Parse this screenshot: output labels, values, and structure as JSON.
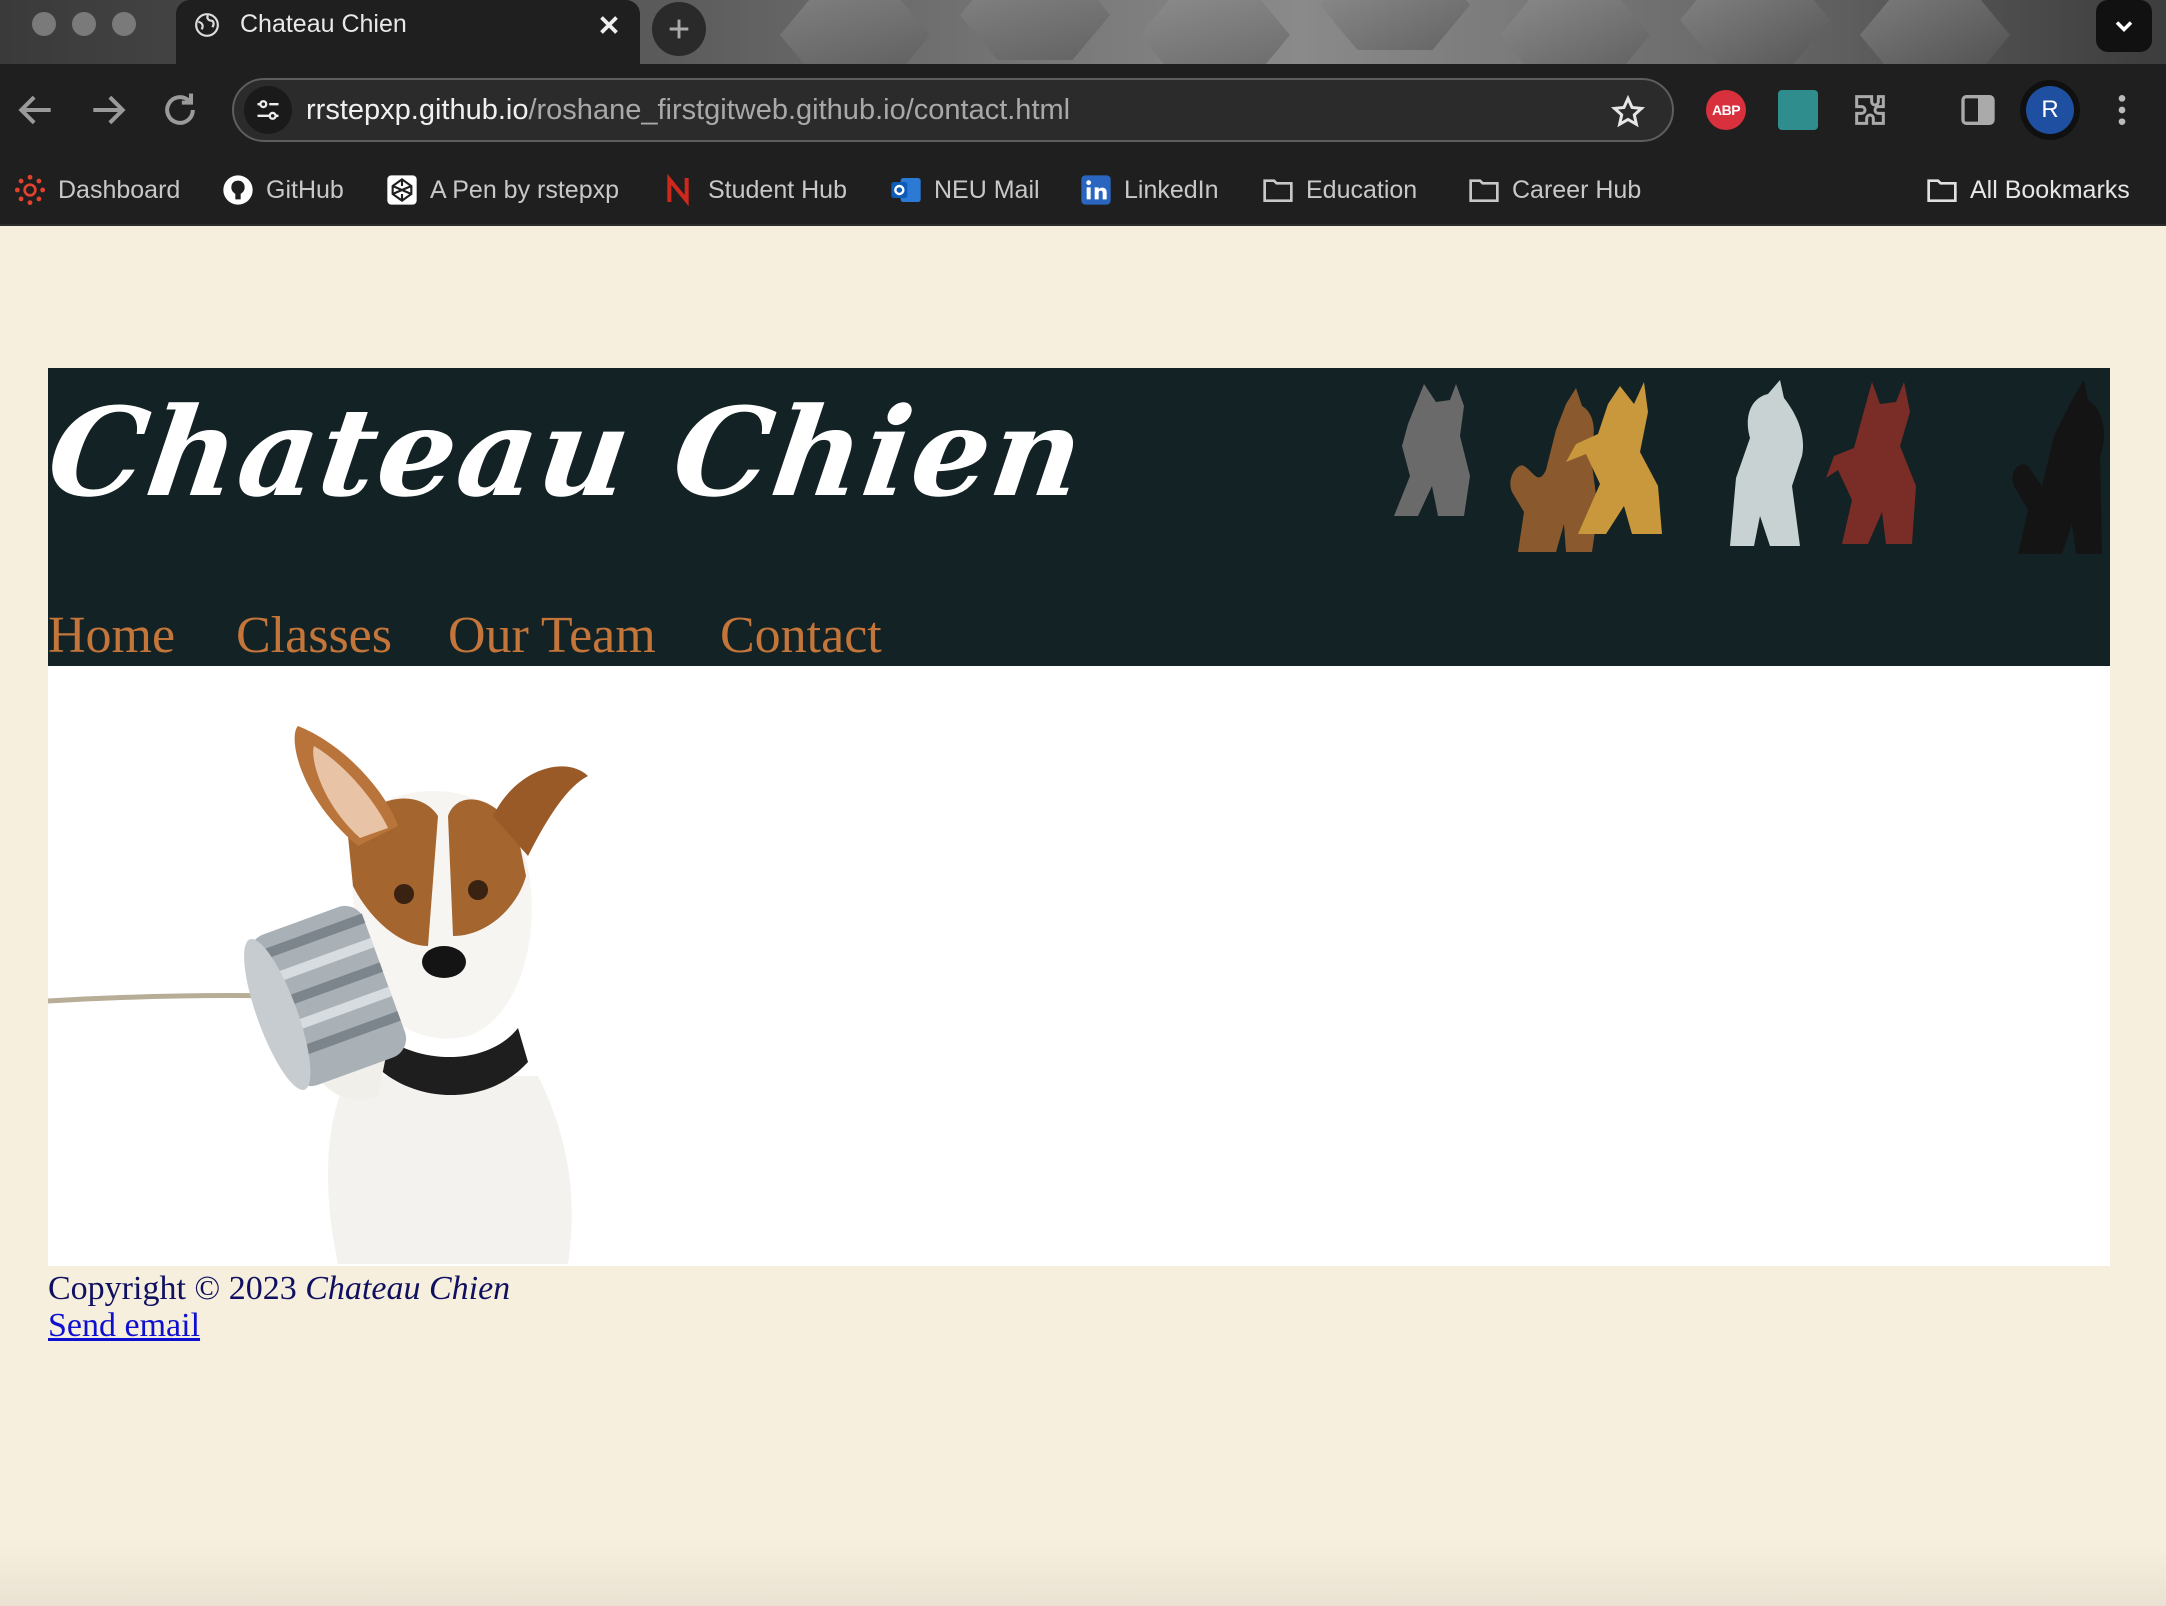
{
  "browser": {
    "tab": {
      "title": "Chateau Chien"
    },
    "address": {
      "host": "rrstepxp.github.io",
      "path": "/roshane_firstgitweb.github.io/contact.html"
    },
    "extensions": {
      "abp_label": "ABP"
    },
    "profile_initial": "R",
    "bookmarks": [
      {
        "label": "Dashboard",
        "icon": "canvas-icon"
      },
      {
        "label": "GitHub",
        "icon": "github-icon"
      },
      {
        "label": "A Pen by rstepxp",
        "icon": "codepen-icon"
      },
      {
        "label": "Student Hub",
        "icon": "neu-logo-icon"
      },
      {
        "label": "NEU Mail",
        "icon": "outlook-icon"
      },
      {
        "label": "LinkedIn",
        "icon": "linkedin-icon"
      },
      {
        "label": "Education",
        "icon": "folder-icon"
      },
      {
        "label": "Career Hub",
        "icon": "folder-icon"
      }
    ],
    "all_bookmarks": "All Bookmarks"
  },
  "site": {
    "logo": "Chateau Chien",
    "nav": [
      "Home",
      "Classes",
      "Our Team",
      "Contact"
    ],
    "footer": {
      "copyright_prefix": "Copyright © 2023 ",
      "brand": "Chateau Chien",
      "email_link": "Send email"
    }
  },
  "colors": {
    "page_bg": "#f6efdd",
    "header_bg": "#132224",
    "nav_link": "#c4753a",
    "footer_text": "#101060",
    "link": "#0f0fd0"
  }
}
